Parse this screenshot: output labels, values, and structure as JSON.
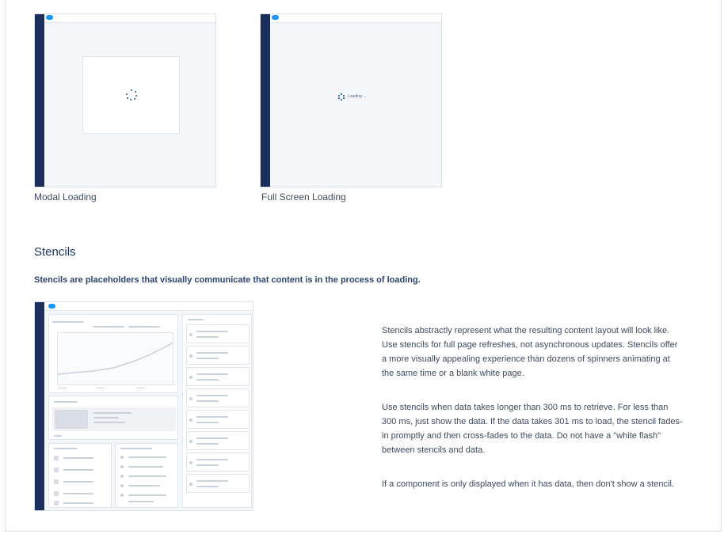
{
  "examples": [
    {
      "caption": "Modal Loading"
    },
    {
      "caption": "Full Screen Loading",
      "loading_text": "Loading ..."
    }
  ],
  "section": {
    "title": "Stencils",
    "lead": "Stencils are placeholders that visually communicate that content is in the process of loading.",
    "paragraphs": [
      "Stencils abstractly represent what the resulting content layout will look like. Use stencils for full page refreshes, not asynchronous updates. Stencils offer a more visually appealing experience than dozens of spinners animating at the same time or a blank white page.",
      "Use stencils when data takes longer than 300 ms to retrieve. For less than 300 ms, just show the data. If the data takes 301 ms to load, the stencil fades-in promptly and then cross-fades to the data. Do not have a \"white flash\" between stencils and data.",
      "If a component is only displayed when it has data, then don't show a stencil."
    ]
  },
  "colors": {
    "nav": "#1b2f5b",
    "brand": "#1b96ff",
    "text": "#3e4a5f",
    "heading": "#16325c"
  }
}
